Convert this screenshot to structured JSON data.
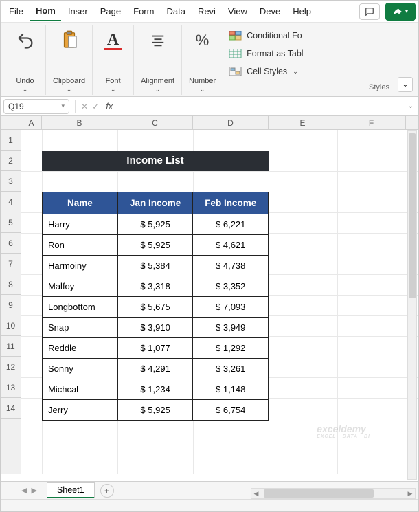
{
  "menu": {
    "tabs": [
      "File",
      "Hom",
      "Inser",
      "Page",
      "Form",
      "Data",
      "Revi",
      "View",
      "Deve",
      "Help"
    ],
    "active_index": 1
  },
  "ribbon": {
    "undo": "Undo",
    "clipboard": "Clipboard",
    "font": "Font",
    "alignment": "Alignment",
    "number": "Number",
    "cond_format": "Conditional Fo",
    "format_table": "Format as Tabl",
    "cell_styles": "Cell Styles",
    "styles_label": "Styles"
  },
  "namebox": {
    "value": "Q19"
  },
  "formula": {
    "fx": "fx",
    "value": ""
  },
  "columns": [
    "A",
    "B",
    "C",
    "D",
    "E",
    "F"
  ],
  "rows": [
    "1",
    "2",
    "3",
    "4",
    "5",
    "6",
    "7",
    "8",
    "9",
    "10",
    "11",
    "12",
    "13",
    "14"
  ],
  "table": {
    "title": "Income List",
    "headers": [
      "Name",
      "Jan Income",
      "Feb Income"
    ],
    "rows": [
      {
        "name": "Harry",
        "jan": "$ 5,925",
        "feb": "$ 6,221"
      },
      {
        "name": "Ron",
        "jan": "$ 5,925",
        "feb": "$ 4,621"
      },
      {
        "name": "Harmoiny",
        "jan": "$ 5,384",
        "feb": "$ 4,738"
      },
      {
        "name": "Malfoy",
        "jan": "$ 3,318",
        "feb": "$ 3,352"
      },
      {
        "name": "Longbottom",
        "jan": "$ 5,675",
        "feb": "$ 7,093"
      },
      {
        "name": "Snap",
        "jan": "$ 3,910",
        "feb": "$ 3,949"
      },
      {
        "name": "Reddle",
        "jan": "$ 1,077",
        "feb": "$ 1,292"
      },
      {
        "name": "Sonny",
        "jan": "$ 4,291",
        "feb": "$ 3,261"
      },
      {
        "name": "Michcal",
        "jan": "$ 1,234",
        "feb": "$ 1,148"
      },
      {
        "name": "Jerry",
        "jan": "$ 5,925",
        "feb": "$ 6,754"
      }
    ]
  },
  "sheet": {
    "name": "Sheet1"
  },
  "watermark": {
    "brand": "exceldemy",
    "sub": "EXCEL · DATA · BI"
  }
}
